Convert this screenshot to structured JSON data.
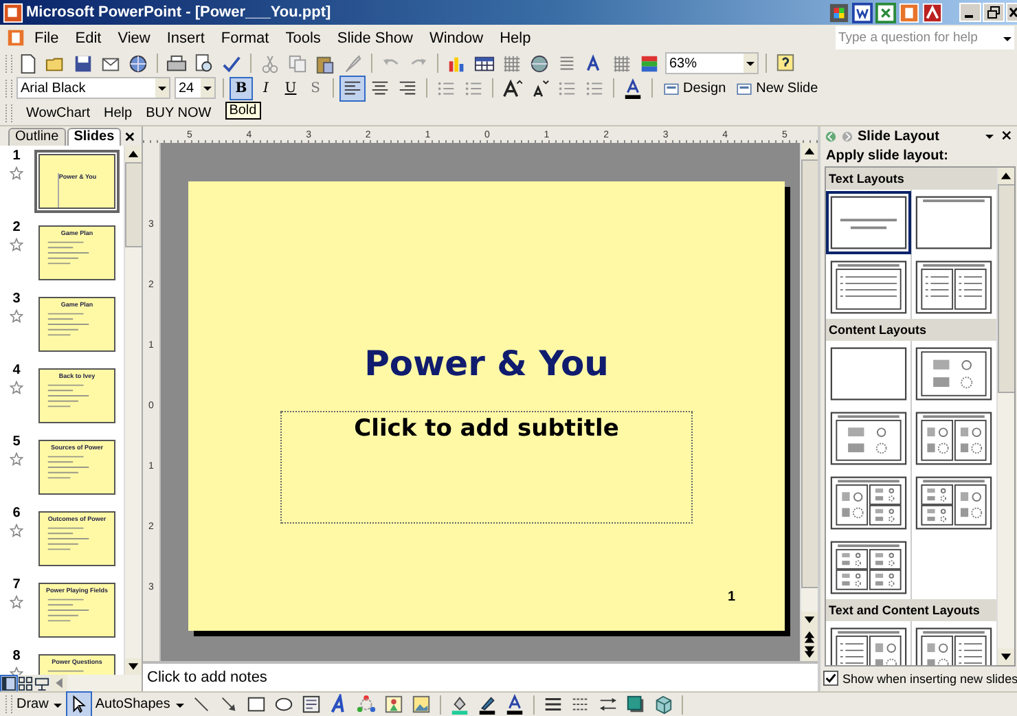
{
  "window": {
    "title": "Microsoft PowerPoint - [Power___You.ppt]"
  },
  "menu": [
    "File",
    "Edit",
    "View",
    "Insert",
    "Format",
    "Tools",
    "Slide Show",
    "Window",
    "Help"
  ],
  "help_box": {
    "placeholder": "Type a question for help"
  },
  "standard_toolbar": {
    "zoom": "63%"
  },
  "formatting_toolbar": {
    "font": "Arial Black",
    "size": "24",
    "styles": [
      {
        "label": "B",
        "kind": "bold",
        "pressed": true
      },
      {
        "label": "I",
        "kind": "italic",
        "pressed": false
      },
      {
        "label": "U",
        "kind": "underline",
        "pressed": false
      },
      {
        "label": "S",
        "kind": "shadow",
        "pressed": false
      }
    ],
    "align": [
      {
        "pressed": true
      },
      {
        "pressed": false
      },
      {
        "pressed": false
      }
    ],
    "buttons": [
      "Design",
      "New Slide"
    ]
  },
  "custom_toolbar": {
    "items": [
      "WowChart",
      "Help",
      "BUY NOW"
    ],
    "tooltip": "Bold"
  },
  "pane_tabs": [
    {
      "label": "Outline",
      "selected": false
    },
    {
      "label": "Slides",
      "selected": true
    }
  ],
  "slides": [
    {
      "number": "1",
      "title": "Power & You",
      "kind": "title",
      "selected": true
    },
    {
      "number": "2",
      "title": "Game Plan",
      "kind": "bullets",
      "selected": false
    },
    {
      "number": "3",
      "title": "Game Plan",
      "kind": "bullets",
      "selected": false
    },
    {
      "number": "4",
      "title": "Back to Ivey",
      "kind": "bullets",
      "selected": false
    },
    {
      "number": "5",
      "title": "Sources of Power",
      "kind": "bullets",
      "selected": false
    },
    {
      "number": "6",
      "title": "Outcomes of Power",
      "kind": "bullets",
      "selected": false
    },
    {
      "number": "7",
      "title": "Power Playing Fields",
      "kind": "bullets",
      "selected": false
    },
    {
      "number": "8",
      "title": "Power Questions",
      "kind": "bullets",
      "selected": false
    }
  ],
  "view_buttons": [
    {
      "kind": "normal",
      "selected": true
    },
    {
      "kind": "sorter",
      "selected": false
    },
    {
      "kind": "show",
      "selected": false
    }
  ],
  "rulers": {
    "horizontal": [
      "5",
      "4",
      "3",
      "2",
      "1",
      "0",
      "1",
      "2",
      "3",
      "4",
      "5"
    ],
    "vertical": [
      "3",
      "2",
      "1",
      "0",
      "1",
      "2",
      "3"
    ]
  },
  "slide": {
    "title": "Power & You",
    "subtitle": "Click to add subtitle",
    "number": "1"
  },
  "notes": {
    "placeholder": "Click to add notes"
  },
  "task_pane": {
    "title": "Slide Layout",
    "heading": "Apply slide layout:",
    "sections": [
      {
        "title": "Text Layouts",
        "layouts": [
          {
            "kind": "title",
            "selected": true
          },
          {
            "kind": "title_only",
            "selected": false
          },
          {
            "kind": "bulleted",
            "selected": false
          },
          {
            "kind": "two_column",
            "selected": false
          }
        ]
      },
      {
        "title": "Content Layouts",
        "layouts": [
          {
            "kind": "blank",
            "selected": false
          },
          {
            "kind": "content",
            "selected": false
          },
          {
            "kind": "title_content",
            "selected": false
          },
          {
            "kind": "title_two_content",
            "selected": false
          },
          {
            "kind": "big_left_two_right",
            "selected": false
          },
          {
            "kind": "two_left_big_right",
            "selected": false
          },
          {
            "kind": "four_content",
            "selected": false
          }
        ]
      },
      {
        "title": "Text and Content Layouts",
        "layouts": [
          {
            "kind": "text_content",
            "selected": false
          },
          {
            "kind": "content_text",
            "selected": false
          }
        ]
      }
    ],
    "show_when_inserting": {
      "label": "Show when inserting new slides",
      "checked": true
    }
  },
  "drawing_toolbar": {
    "menus": [
      "Draw",
      "AutoShapes"
    ]
  }
}
